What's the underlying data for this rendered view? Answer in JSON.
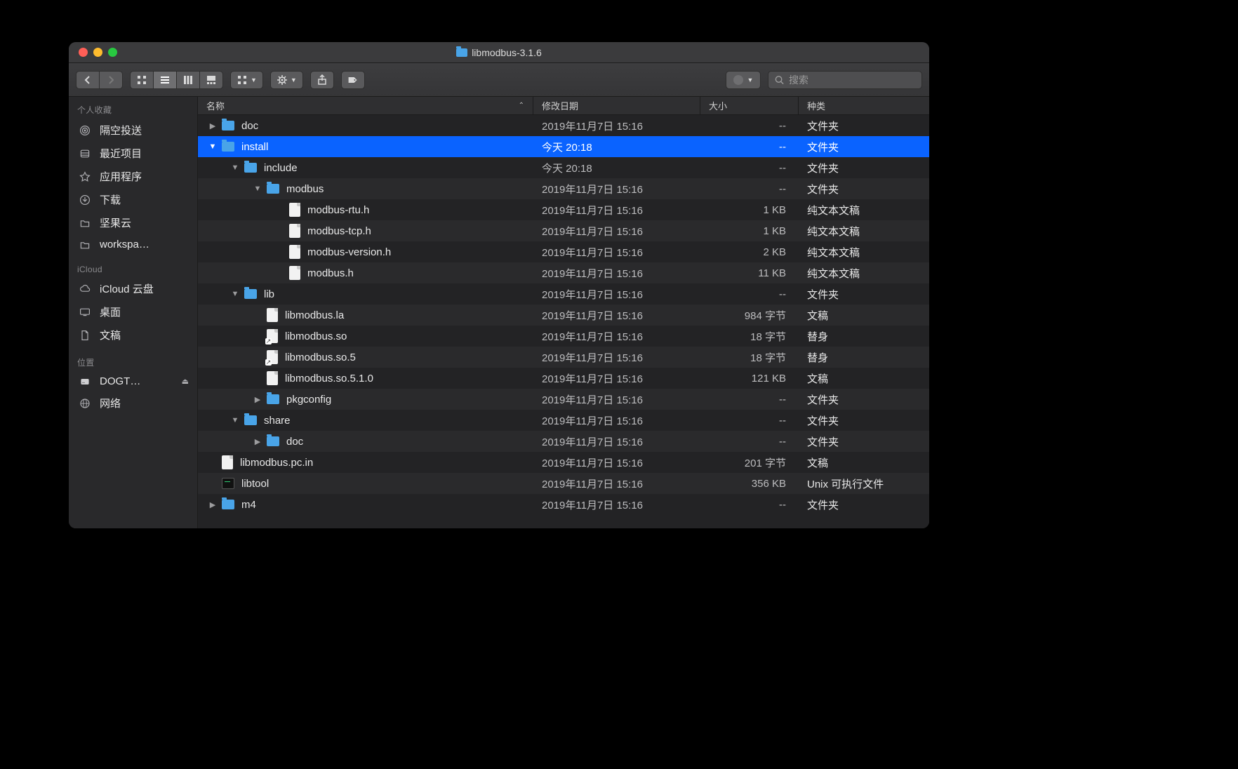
{
  "window": {
    "title": "libmodbus-3.1.6"
  },
  "search": {
    "placeholder": "搜索"
  },
  "sidebar": {
    "sections": [
      {
        "heading": "个人收藏",
        "items": [
          {
            "label": "隔空投送",
            "icon": "airdrop-icon"
          },
          {
            "label": "最近项目",
            "icon": "recents-icon"
          },
          {
            "label": "应用程序",
            "icon": "apps-icon"
          },
          {
            "label": "下载",
            "icon": "downloads-icon"
          },
          {
            "label": "坚果云",
            "icon": "folder-icon"
          },
          {
            "label": "workspa…",
            "icon": "folder-icon"
          }
        ]
      },
      {
        "heading": "iCloud",
        "items": [
          {
            "label": "iCloud 云盘",
            "icon": "cloud-icon"
          },
          {
            "label": "桌面",
            "icon": "desktop-icon"
          },
          {
            "label": "文稿",
            "icon": "documents-icon"
          }
        ]
      },
      {
        "heading": "位置",
        "items": [
          {
            "label": "DOGT…",
            "icon": "disk-icon",
            "eject": true
          },
          {
            "label": "网络",
            "icon": "network-icon"
          }
        ]
      }
    ]
  },
  "columns": {
    "name": "名称",
    "date": "修改日期",
    "size": "大小",
    "kind": "种类"
  },
  "rows": [
    {
      "depth": 0,
      "disclosure": "right",
      "type": "folder",
      "name": "doc",
      "date": "2019年11月7日 15:16",
      "size": "--",
      "kind": "文件夹",
      "selected": false
    },
    {
      "depth": 0,
      "disclosure": "down",
      "type": "folder",
      "name": "install",
      "date": "今天 20:18",
      "size": "--",
      "kind": "文件夹",
      "selected": true
    },
    {
      "depth": 1,
      "disclosure": "down",
      "type": "folder",
      "name": "include",
      "date": "今天 20:18",
      "size": "--",
      "kind": "文件夹",
      "selected": false
    },
    {
      "depth": 2,
      "disclosure": "down",
      "type": "folder",
      "name": "modbus",
      "date": "2019年11月7日 15:16",
      "size": "--",
      "kind": "文件夹",
      "selected": false
    },
    {
      "depth": 3,
      "disclosure": "",
      "type": "file",
      "name": "modbus-rtu.h",
      "date": "2019年11月7日 15:16",
      "size": "1 KB",
      "kind": "纯文本文稿",
      "selected": false
    },
    {
      "depth": 3,
      "disclosure": "",
      "type": "file",
      "name": "modbus-tcp.h",
      "date": "2019年11月7日 15:16",
      "size": "1 KB",
      "kind": "纯文本文稿",
      "selected": false
    },
    {
      "depth": 3,
      "disclosure": "",
      "type": "file",
      "name": "modbus-version.h",
      "date": "2019年11月7日 15:16",
      "size": "2 KB",
      "kind": "纯文本文稿",
      "selected": false
    },
    {
      "depth": 3,
      "disclosure": "",
      "type": "file",
      "name": "modbus.h",
      "date": "2019年11月7日 15:16",
      "size": "11 KB",
      "kind": "纯文本文稿",
      "selected": false
    },
    {
      "depth": 1,
      "disclosure": "down",
      "type": "folder",
      "name": "lib",
      "date": "2019年11月7日 15:16",
      "size": "--",
      "kind": "文件夹",
      "selected": false
    },
    {
      "depth": 2,
      "disclosure": "",
      "type": "file",
      "name": "libmodbus.la",
      "date": "2019年11月7日 15:16",
      "size": "984 字节",
      "kind": "文稿",
      "selected": false
    },
    {
      "depth": 2,
      "disclosure": "",
      "type": "alias",
      "name": "libmodbus.so",
      "date": "2019年11月7日 15:16",
      "size": "18 字节",
      "kind": "替身",
      "selected": false
    },
    {
      "depth": 2,
      "disclosure": "",
      "type": "alias",
      "name": "libmodbus.so.5",
      "date": "2019年11月7日 15:16",
      "size": "18 字节",
      "kind": "替身",
      "selected": false
    },
    {
      "depth": 2,
      "disclosure": "",
      "type": "file",
      "name": "libmodbus.so.5.1.0",
      "date": "2019年11月7日 15:16",
      "size": "121 KB",
      "kind": "文稿",
      "selected": false
    },
    {
      "depth": 2,
      "disclosure": "right",
      "type": "folder",
      "name": "pkgconfig",
      "date": "2019年11月7日 15:16",
      "size": "--",
      "kind": "文件夹",
      "selected": false
    },
    {
      "depth": 1,
      "disclosure": "down",
      "type": "folder",
      "name": "share",
      "date": "2019年11月7日 15:16",
      "size": "--",
      "kind": "文件夹",
      "selected": false
    },
    {
      "depth": 2,
      "disclosure": "right",
      "type": "folder",
      "name": "doc",
      "date": "2019年11月7日 15:16",
      "size": "--",
      "kind": "文件夹",
      "selected": false
    },
    {
      "depth": 0,
      "disclosure": "",
      "type": "file",
      "name": "libmodbus.pc.in",
      "date": "2019年11月7日 15:16",
      "size": "201 字节",
      "kind": "文稿",
      "selected": false
    },
    {
      "depth": 0,
      "disclosure": "",
      "type": "exec",
      "name": "libtool",
      "date": "2019年11月7日 15:16",
      "size": "356 KB",
      "kind": "Unix 可执行文件",
      "selected": false
    },
    {
      "depth": 0,
      "disclosure": "right",
      "type": "folder",
      "name": "m4",
      "date": "2019年11月7日 15:16",
      "size": "--",
      "kind": "文件夹",
      "selected": false
    }
  ]
}
